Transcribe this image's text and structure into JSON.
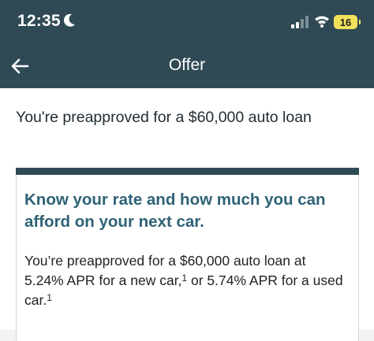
{
  "status_bar": {
    "time": "12:35",
    "battery": "16",
    "icons": [
      "moon-icon",
      "cellular-signal-icon",
      "wifi-icon",
      "battery-icon"
    ]
  },
  "nav": {
    "title": "Offer",
    "back_icon": "back-arrow-icon"
  },
  "content": {
    "heading": "You're preapproved for a $60,000 auto loan",
    "card": {
      "headline": "Know your rate and how much you can afford on your next car.",
      "body_part1": "You’re preapproved for a $60,000 auto loan at 5.24% APR for a new car,",
      "footnote1": "1",
      "body_part2": " or 5.74% APR for a used car.",
      "footnote2": "1"
    }
  },
  "colors": {
    "header_bg": "#2f4a55",
    "accent_text": "#2f6276",
    "battery_fill": "#f2e15a"
  }
}
